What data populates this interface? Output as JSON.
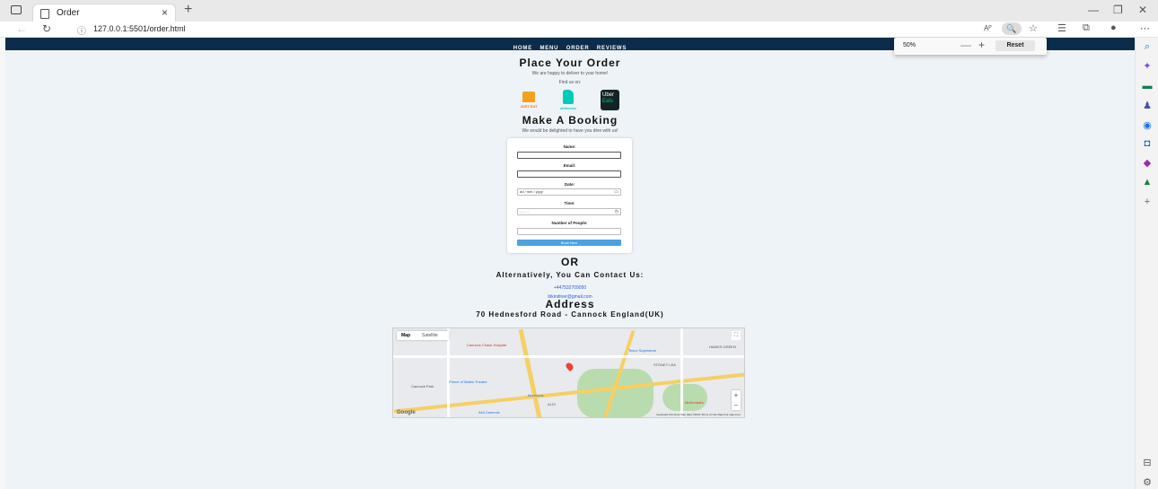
{
  "browser": {
    "tab_title": "Order",
    "tab_close": "×",
    "new_tab": "+",
    "url": "127.0.0.1:5501/order.html",
    "zoom_popup": {
      "percent": "50%",
      "minus": "—",
      "plus": "+",
      "reset": "Reset"
    },
    "read_aloud": "Aᴾ"
  },
  "site": {
    "nav": [
      "HOME",
      "MENU",
      "ORDER",
      "REVIEWS"
    ],
    "order_title": "Place Your Order",
    "order_sub": "We are happy to deliver to your home!",
    "find_us": "Find us on:",
    "logos": {
      "just_eat": "JUST EAT",
      "deliveroo": "deliveroo",
      "uber1": "Uber",
      "uber2": "Eats"
    },
    "booking_title": "Make A Booking",
    "booking_sub": "We would be delighted to have you dine with us!",
    "form": {
      "name_label": "Name:",
      "email_label": "Email:",
      "date_label": "Date:",
      "date_placeholder": "dd / mm / yyyy",
      "time_label": "Time:",
      "time_placeholder": "--:-- --",
      "people_label": "Number of People:",
      "submit": "Book Now"
    },
    "or": "OR",
    "contact_title": "Alternatively, You Can Contact Us:",
    "phone": "+447532709050",
    "email": "bikindiner@gmail.com",
    "address_title": "Address",
    "address": "70 Hednesford Road - Cannock England(UK)",
    "map": {
      "map_btn": "Map",
      "satellite_btn": "Satellite",
      "google": "Google",
      "attribution": "Keyboard shortcuts  Map data ©2024  Terms of Use  Report a map error",
      "labels": {
        "hospital": "Cannock Chase Hospital",
        "superstore": "Tesco Superstore",
        "theatre": "Prince of Wales Theatre",
        "park": "Cannock Park",
        "stoney": "STONEY LEA",
        "hawks": "HAWKS GREEN",
        "mcd": "McDonald's",
        "aldi": "ALDI",
        "morrisons": "Morrisons",
        "aldi2": "Aldi Cannock"
      }
    }
  }
}
